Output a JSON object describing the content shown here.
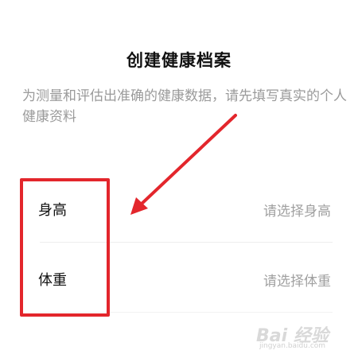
{
  "header": {
    "title": "创建健康档案",
    "subtitle": "为测量和评估出准确的健康数据，请先填写真实的个人健康资料"
  },
  "form": {
    "rows": [
      {
        "label": "身高",
        "value_placeholder": "请选择身高"
      },
      {
        "label": "体重",
        "value_placeholder": "请选择体重"
      }
    ]
  },
  "annotation": {
    "color": "#e3262c"
  },
  "watermark": {
    "logo_text": "Bai 经验",
    "url_text": "jingyan.baidu.com"
  }
}
